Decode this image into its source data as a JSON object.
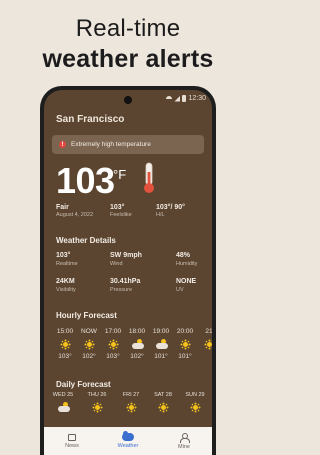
{
  "headline": {
    "line1": "Real-time",
    "line2": "weather alerts"
  },
  "status_bar": {
    "time": "12:30"
  },
  "city": "San Francisco",
  "alert": {
    "text": "Extremely high temperature",
    "icon": "warning-icon"
  },
  "current": {
    "temperature": "103",
    "unit": "°F",
    "icon": "thermometer-icon",
    "condition": {
      "value": "Fair",
      "label": "August 4, 2022"
    },
    "feels": {
      "value": "103°",
      "label": "Feelslike"
    },
    "hilo": {
      "value": "103°/ 90°",
      "label": "H/L"
    }
  },
  "details": {
    "title": "Weather Details",
    "cells": [
      {
        "value": "103°",
        "label": "Realtime"
      },
      {
        "value": "SW 9mph",
        "label": "Wind"
      },
      {
        "value": "48%",
        "label": "Humidity"
      },
      {
        "value": "24KM",
        "label": "Visibility"
      },
      {
        "value": "30.41hPa",
        "label": "Pressure"
      },
      {
        "value": "NONE",
        "label": "UV"
      }
    ]
  },
  "hourly": {
    "title": "Hourly Forecast",
    "items": [
      {
        "time": "15:00",
        "icon": "sun-icon",
        "temp": "103°"
      },
      {
        "time": "NOW",
        "icon": "sun-icon",
        "temp": "102°"
      },
      {
        "time": "17:00",
        "icon": "sun-icon",
        "temp": "103°"
      },
      {
        "time": "18:00",
        "icon": "partly-cloudy-icon",
        "temp": "102°"
      },
      {
        "time": "19:00",
        "icon": "partly-cloudy-icon",
        "temp": "101°"
      },
      {
        "time": "20:00",
        "icon": "sun-icon",
        "temp": "101°"
      },
      {
        "time": "21",
        "icon": "sun-icon",
        "temp": ""
      }
    ]
  },
  "daily": {
    "title": "Daily Forecast",
    "items": [
      {
        "day": "WED 25",
        "icon": "partly-cloudy-icon"
      },
      {
        "day": "THU 26",
        "icon": "sun-icon"
      },
      {
        "day": "FRI 27",
        "icon": "sun-icon"
      },
      {
        "day": "SAT 28",
        "icon": "sun-icon"
      },
      {
        "day": "SUN 29",
        "icon": "sun-icon"
      }
    ]
  },
  "nav": {
    "items": [
      {
        "label": "News",
        "icon": "news-icon"
      },
      {
        "label": "Weather",
        "icon": "weather-icon"
      },
      {
        "label": "Mine",
        "icon": "person-icon"
      }
    ]
  },
  "colors": {
    "background": "#ede6dd",
    "screen": "#5b4531",
    "accent": "#3a6fd0",
    "sun": "#f5c21b",
    "alert": "#e0463e"
  }
}
